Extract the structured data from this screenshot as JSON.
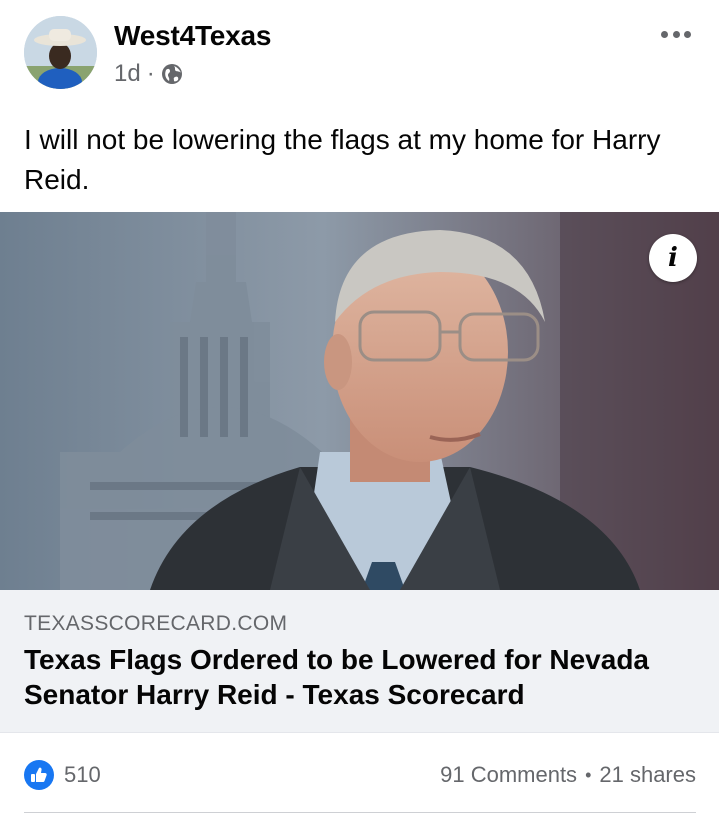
{
  "post": {
    "author": "West4Texas",
    "time": "1d",
    "separator": "·",
    "privacy_icon": "globe-icon",
    "text": "I will not be lowering the flags at my home for Harry Reid."
  },
  "link": {
    "domain": "TEXASSCORECARD.COM",
    "title": "Texas Flags Ordered to be Lowered for Nevada Senator Harry Reid - Texas Scorecard",
    "info_label": "i"
  },
  "stats": {
    "likes": "510",
    "comments": "91 Comments",
    "dot": "•",
    "shares": "21 shares"
  },
  "colors": {
    "accent": "#1877f2",
    "secondary_text": "#65676b",
    "link_background": "#f0f2f5"
  }
}
